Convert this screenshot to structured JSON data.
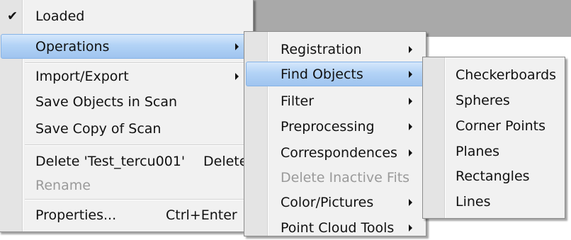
{
  "context_menu": {
    "items": [
      {
        "label": "Loaded",
        "checked": true
      },
      {
        "label": "Operations",
        "has_submenu": true,
        "highlighted": true
      },
      {
        "label": "Import/Export",
        "has_submenu": true
      },
      {
        "label": "Save Objects in Scan"
      },
      {
        "label": "Save Copy of Scan"
      },
      {
        "label": "Delete 'Test_tercu001'",
        "shortcut": "Delete"
      },
      {
        "label": "Rename",
        "disabled": true
      },
      {
        "label": "Properties...",
        "shortcut": "Ctrl+Enter"
      }
    ]
  },
  "operations_menu": {
    "items": [
      {
        "label": "Registration",
        "has_submenu": true
      },
      {
        "label": "Find Objects",
        "has_submenu": true,
        "highlighted": true
      },
      {
        "label": "Filter",
        "has_submenu": true
      },
      {
        "label": "Preprocessing",
        "has_submenu": true
      },
      {
        "label": "Correspondences",
        "has_submenu": true
      },
      {
        "label": "Delete Inactive Fits",
        "disabled": true
      },
      {
        "label": "Color/Pictures",
        "has_submenu": true
      },
      {
        "label": "Point Cloud Tools",
        "has_submenu": true
      }
    ]
  },
  "find_objects_menu": {
    "items": [
      {
        "label": "Checkerboards"
      },
      {
        "label": "Spheres"
      },
      {
        "label": "Corner Points"
      },
      {
        "label": "Planes"
      },
      {
        "label": "Rectangles"
      },
      {
        "label": "Lines"
      }
    ]
  },
  "colors": {
    "highlight": "#b3d3f6",
    "menu_background": "#f1f1f1",
    "gutter": "#e4e4e4",
    "app_background": "#a9a9a9",
    "disabled_text": "#9a9a9a"
  }
}
